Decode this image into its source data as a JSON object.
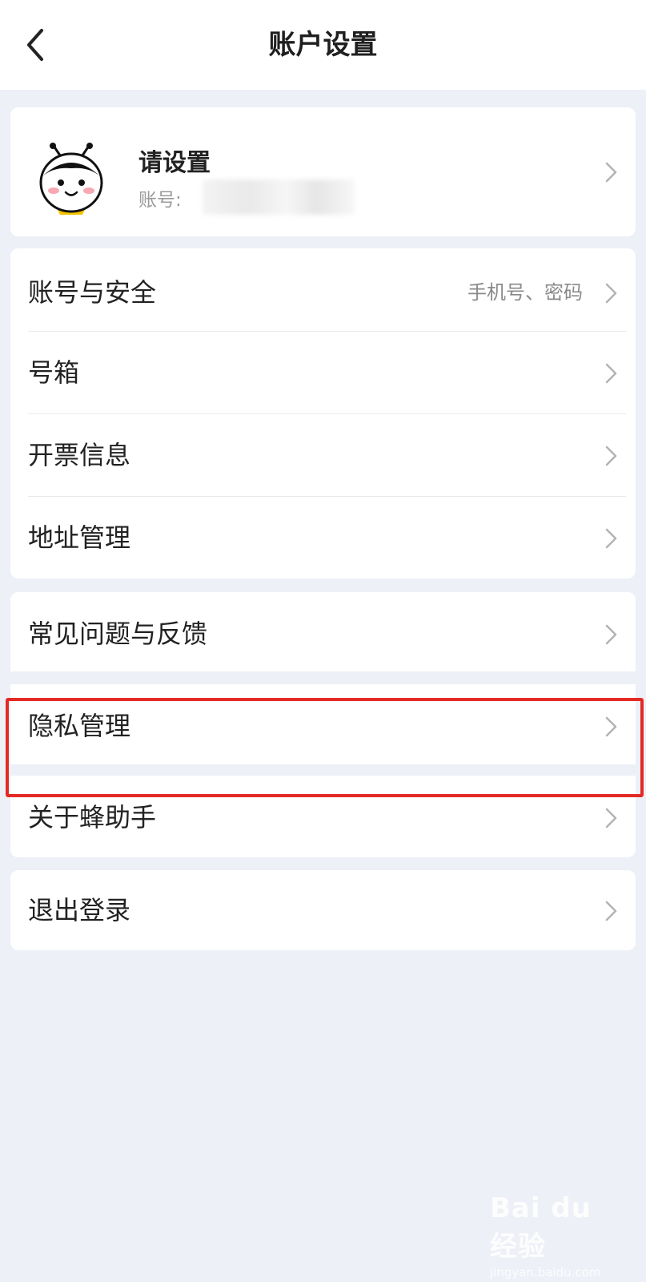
{
  "header": {
    "title": "账户设置"
  },
  "profile": {
    "name": "请设置",
    "account_label": "账号:"
  },
  "group1": [
    {
      "label": "账号与安全",
      "value": "手机号、密码"
    },
    {
      "label": "号箱"
    },
    {
      "label": "开票信息"
    },
    {
      "label": "地址管理"
    }
  ],
  "group2": [
    {
      "label": "常见问题与反馈"
    },
    {
      "label": "隐私管理"
    },
    {
      "label": "关于蜂助手"
    }
  ],
  "group3": [
    {
      "label": "退出登录"
    }
  ],
  "watermark": {
    "logo": "Bai du 经验",
    "url": "jingyan.baidu.com"
  },
  "colors": {
    "background": "#edf0f7",
    "highlight": "#e42a24",
    "card": "#ffffff"
  }
}
